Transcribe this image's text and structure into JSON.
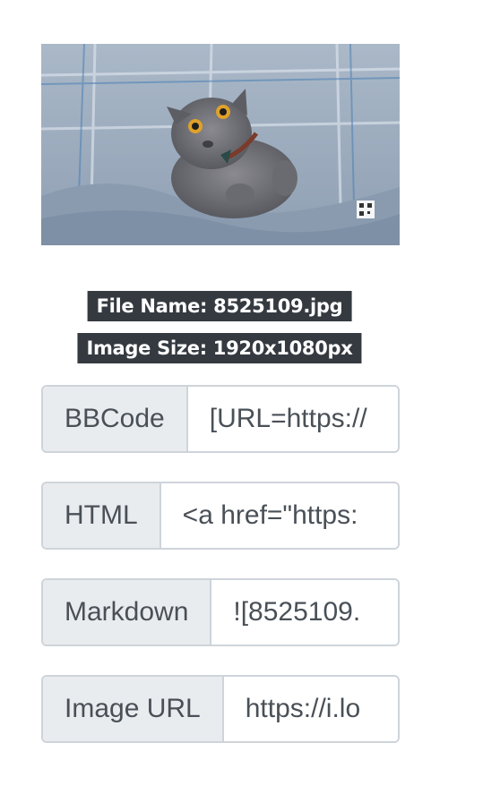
{
  "preview": {
    "icon": "photo-preview"
  },
  "info": {
    "file_name": "File Name: 8525109.jpg",
    "image_size": "Image Size: 1920x1080px"
  },
  "links": [
    {
      "label": "BBCode",
      "value": "[URL=https://"
    },
    {
      "label": "HTML",
      "value": "<a href=\"https:"
    },
    {
      "label": "Markdown",
      "value": "![8525109."
    },
    {
      "label": "Image URL",
      "value": "https://i.lo"
    }
  ],
  "colors": {
    "badge_bg": "#343a40",
    "label_bg": "#e9ecef",
    "border": "#ced4da",
    "text": "#495057"
  }
}
